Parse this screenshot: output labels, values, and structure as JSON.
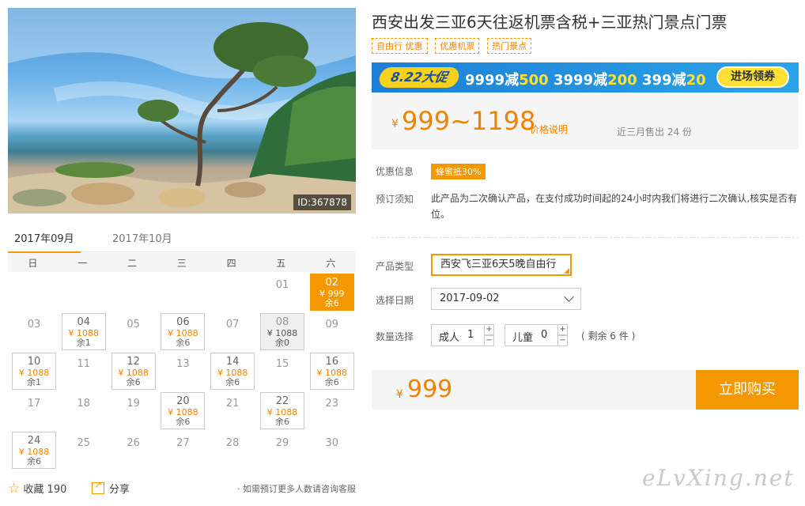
{
  "photo": {
    "id_label": "ID:367878"
  },
  "calendar": {
    "months": [
      "2017年09月",
      "2017年10月"
    ],
    "weekdays": [
      "日",
      "一",
      "二",
      "三",
      "四",
      "五",
      "六"
    ],
    "days": [
      {
        "day": "01",
        "col": 5,
        "row": 0
      },
      {
        "day": "02",
        "col": 6,
        "row": 0,
        "price": "¥ 999",
        "stock": "余6",
        "state": "selected"
      },
      {
        "day": "03",
        "col": 0,
        "row": 1
      },
      {
        "day": "04",
        "col": 1,
        "row": 1,
        "price": "¥ 1088",
        "stock": "余1",
        "state": "avail"
      },
      {
        "day": "05",
        "col": 2,
        "row": 1
      },
      {
        "day": "06",
        "col": 3,
        "row": 1,
        "price": "¥ 1088",
        "stock": "余6",
        "state": "avail"
      },
      {
        "day": "07",
        "col": 4,
        "row": 1
      },
      {
        "day": "08",
        "col": 5,
        "row": 1,
        "price": "¥ 1088",
        "stock": "余0",
        "state": "soldout"
      },
      {
        "day": "09",
        "col": 6,
        "row": 1
      },
      {
        "day": "10",
        "col": 0,
        "row": 2,
        "price": "¥ 1088",
        "stock": "余1",
        "state": "avail"
      },
      {
        "day": "11",
        "col": 1,
        "row": 2
      },
      {
        "day": "12",
        "col": 2,
        "row": 2,
        "price": "¥ 1088",
        "stock": "余6",
        "state": "avail"
      },
      {
        "day": "13",
        "col": 3,
        "row": 2
      },
      {
        "day": "14",
        "col": 4,
        "row": 2,
        "price": "¥ 1088",
        "stock": "余6",
        "state": "avail"
      },
      {
        "day": "15",
        "col": 5,
        "row": 2
      },
      {
        "day": "16",
        "col": 6,
        "row": 2,
        "price": "¥ 1088",
        "stock": "余6",
        "state": "avail"
      },
      {
        "day": "17",
        "col": 0,
        "row": 3
      },
      {
        "day": "18",
        "col": 1,
        "row": 3
      },
      {
        "day": "19",
        "col": 2,
        "row": 3
      },
      {
        "day": "20",
        "col": 3,
        "row": 3,
        "price": "¥ 1088",
        "stock": "余6",
        "state": "avail"
      },
      {
        "day": "21",
        "col": 4,
        "row": 3
      },
      {
        "day": "22",
        "col": 5,
        "row": 3,
        "price": "¥ 1088",
        "stock": "余6",
        "state": "avail"
      },
      {
        "day": "23",
        "col": 6,
        "row": 3
      },
      {
        "day": "24",
        "col": 0,
        "row": 4,
        "price": "¥ 1088",
        "stock": "余6",
        "state": "avail"
      },
      {
        "day": "25",
        "col": 1,
        "row": 4
      },
      {
        "day": "26",
        "col": 2,
        "row": 4
      },
      {
        "day": "27",
        "col": 3,
        "row": 4
      },
      {
        "day": "28",
        "col": 4,
        "row": 4
      },
      {
        "day": "29",
        "col": 5,
        "row": 4
      },
      {
        "day": "30",
        "col": 6,
        "row": 4
      }
    ]
  },
  "actions": {
    "favorite_label": "收藏",
    "favorite_count": "190",
    "share_label": "分享",
    "consult_text": "· 如需预订更多人数请咨询客服"
  },
  "product": {
    "title": "西安出发三亚6天往返机票含税+三亚热门景点门票",
    "tags": [
      "自由行 优惠",
      "优惠机票",
      "热门景点"
    ],
    "promo": {
      "badge": "8.22大促",
      "deals": [
        {
          "pre": "9999减",
          "amt": "500"
        },
        {
          "pre": "3999减",
          "amt": "200"
        },
        {
          "pre": "399减",
          "amt": "20"
        }
      ],
      "button": "进场领券"
    },
    "price_currency": "¥",
    "price_range": "999~1198",
    "price_note": "价格说明",
    "sold_text": "近三月售出 24 份",
    "discount_label": "优惠信息",
    "discount_badge": "蜂蜜抵30%",
    "notice_label": "预订须知",
    "notice_text": "此产品为二次确认产品，在支付成功时间起的24小时内我们将进行二次确认,核实是否有位。",
    "type_label": "产品类型",
    "type_value": "西安飞三亚6天5晚自由行",
    "date_label": "选择日期",
    "date_value": "2017-09-02",
    "qty_label": "数量选择",
    "adult_label": "成人",
    "adult_value": "1",
    "child_label": "儿童",
    "child_value": "0",
    "remaining": "( 剩余 6 件 )",
    "total_currency": "¥",
    "total_price": "999",
    "buy_button": "立即购买"
  },
  "watermark": "eLvXing.net",
  "colors": {
    "accent": "#f39800",
    "price": "#f08300",
    "promo_blue": "#1d7fd6"
  }
}
